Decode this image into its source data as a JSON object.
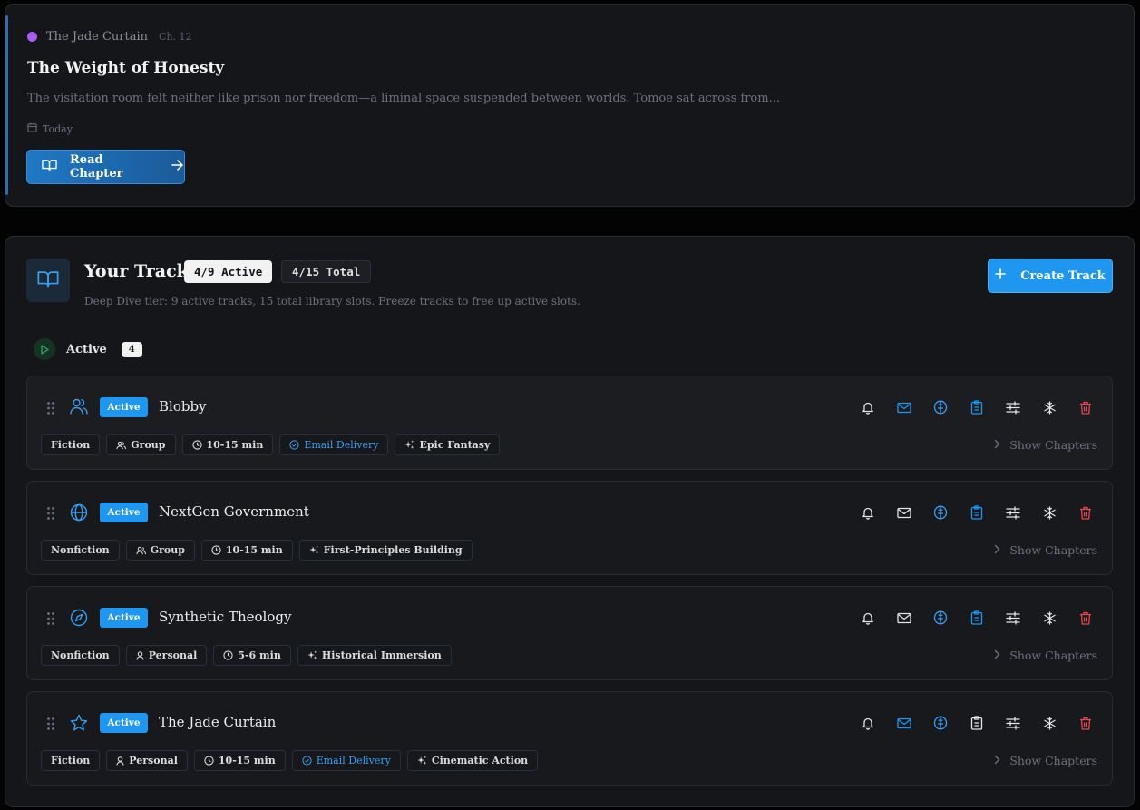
{
  "chapter": {
    "series": "The Jade Curtain",
    "chapter_no": "Ch. 12",
    "title": "The Weight of Honesty",
    "excerpt": "The visitation room felt neither like prison nor freedom—a liminal space suspended between worlds. Tomoe sat across from...",
    "date": "Today",
    "read_label": "Read Chapter",
    "series_color": "#a85ef0"
  },
  "tracks_panel": {
    "title": "Your Tracks",
    "active_count": "4/9 Active",
    "total_count": "4/15 Total",
    "subtitle": "Deep Dive tier: 9 active tracks, 15 total library slots. Freeze tracks to free up active slots.",
    "create_label": "Create Track",
    "section_label": "Active",
    "section_count": "4"
  },
  "tracks": [
    {
      "name": "Blobby",
      "status": "Active",
      "icon": "users-icon",
      "tags": {
        "genre": "Fiction",
        "audience": "Group",
        "length": "10-15 min",
        "delivery": "Email Delivery",
        "style": "Epic Fantasy"
      },
      "show_label": "Show Chapters",
      "mail_highlight": true,
      "clipboard_highlight": true
    },
    {
      "name": "NextGen Government",
      "status": "Active",
      "icon": "globe-icon",
      "tags": {
        "genre": "Nonfiction",
        "audience": "Group",
        "length": "10-15 min",
        "style": "First-Principles Building"
      },
      "show_label": "Show Chapters",
      "mail_highlight": false,
      "clipboard_highlight": true
    },
    {
      "name": "Synthetic Theology",
      "status": "Active",
      "icon": "compass-icon",
      "tags": {
        "genre": "Nonfiction",
        "audience": "Personal",
        "length": "5-6 min",
        "style": "Historical Immersion"
      },
      "show_label": "Show Chapters",
      "mail_highlight": false,
      "clipboard_highlight": true
    },
    {
      "name": "The Jade Curtain",
      "status": "Active",
      "icon": "star-icon",
      "tags": {
        "genre": "Fiction",
        "audience": "Personal",
        "length": "10-15 min",
        "delivery": "Email Delivery",
        "style": "Cinematic Action"
      },
      "show_label": "Show Chapters",
      "mail_highlight": true,
      "clipboard_highlight": false
    }
  ],
  "colors": {
    "accent": "#1f96ef",
    "danger": "#e5484d",
    "icon_default": "#e6e6e6"
  }
}
